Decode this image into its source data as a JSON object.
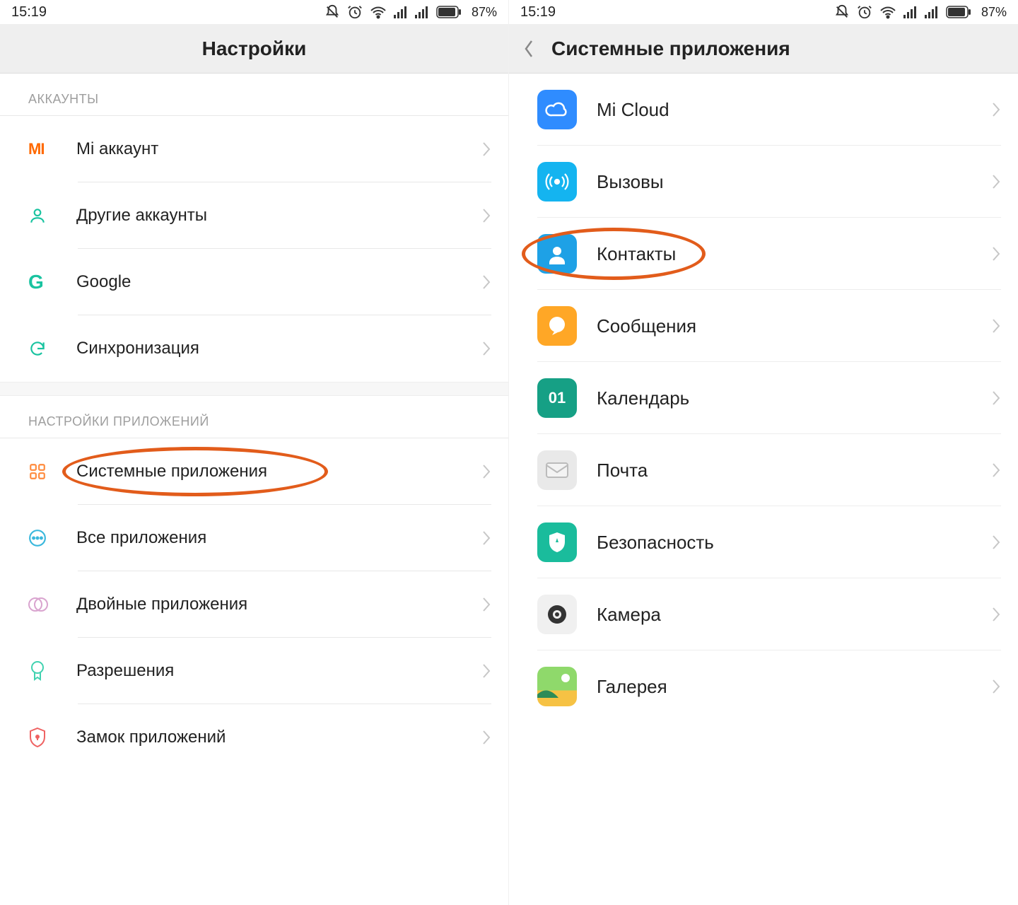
{
  "status": {
    "time": "15:19",
    "battery": "87%"
  },
  "left": {
    "title": "Настройки",
    "section_accounts": "АККАУНТЫ",
    "section_appsettings": "НАСТРОЙКИ ПРИЛОЖЕНИЙ",
    "rows": {
      "mi_account": "Mi аккаунт",
      "other_accounts": "Другие аккаунты",
      "google": "Google",
      "sync": "Синхронизация",
      "system_apps": "Системные приложения",
      "all_apps": "Все приложения",
      "dual_apps": "Двойные приложения",
      "permissions": "Разрешения",
      "app_lock": "Замок приложений"
    }
  },
  "right": {
    "title": "Системные приложения",
    "rows": {
      "mi_cloud": "Mi Cloud",
      "calls": "Вызовы",
      "contacts": "Контакты",
      "messages": "Сообщения",
      "calendar": "Календарь",
      "mail": "Почта",
      "security": "Безопасность",
      "camera": "Камера",
      "gallery": "Галерея"
    },
    "calendar_badge": "01"
  }
}
